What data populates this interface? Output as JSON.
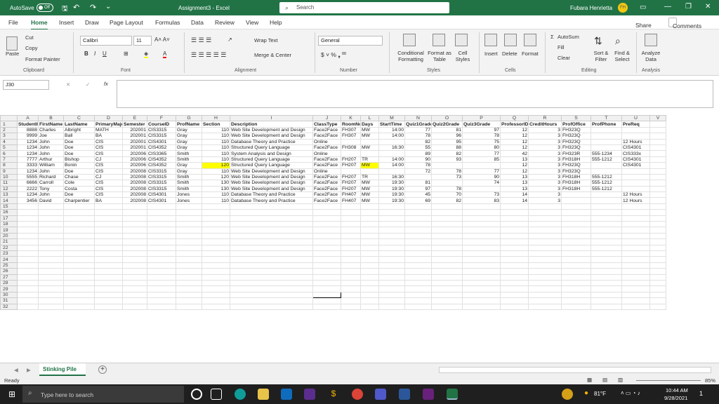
{
  "titlebar": {
    "autosave": "AutoSave",
    "toggle": "Off",
    "title": "Assignment3 - Excel",
    "search": "Search",
    "user": "Fubara Henrietta",
    "initials": "FH"
  },
  "menu": {
    "items": [
      "File",
      "Home",
      "Insert",
      "Draw",
      "Page Layout",
      "Formulas",
      "Data",
      "Review",
      "View",
      "Help"
    ],
    "share": "Share",
    "comments": "Comments"
  },
  "ribbon": {
    "cut": "Cut",
    "copy": "Copy",
    "paste": "Paste",
    "format_painter": "Format Painter",
    "clipboard": "Clipboard",
    "font_name": "Calibri",
    "font_size": "11",
    "font": "Font",
    "wrap": "Wrap Text",
    "merge": "Merge & Center",
    "alignment": "Alignment",
    "number_format": "General",
    "number": "Number",
    "cond": "Conditional Formatting",
    "format_table": "Format as Table",
    "cell_styles": "Cell Styles",
    "styles": "Styles",
    "insert": "Insert",
    "delete": "Delete",
    "format": "Format",
    "cells": "Cells",
    "autosum": "AutoSum",
    "fill": "Fill",
    "clear": "Clear",
    "sort": "Sort & Filter",
    "find": "Find & Select",
    "editing": "Editing",
    "analyze": "Analyze Data",
    "analysis": "Analysis"
  },
  "namebox": "J30",
  "columns": [
    "A",
    "B",
    "C",
    "D",
    "E",
    "F",
    "G",
    "H",
    "I",
    "J",
    "K",
    "L",
    "M",
    "N",
    "O",
    "P",
    "Q",
    "R",
    "S",
    "T",
    "U",
    "V"
  ],
  "rows": [
    [
      "StudentID",
      "FirstName",
      "LastName",
      "PrimaryMajor",
      "Semester",
      "CourseID",
      "ProfName",
      "Section",
      "Description",
      "ClassType",
      "RoomNo",
      "Days",
      "StartTime",
      "Quiz1Grade",
      "Quiz2Grade",
      "Quiz3Grade",
      "ProfessorID",
      "CreditHours",
      "ProfOffice",
      "ProfPhone",
      "PreReq"
    ],
    [
      "8888",
      "Charles",
      "Albright",
      "MATH",
      "202001",
      "CIS3315",
      "Gray",
      "110",
      "Web Site Development and Design",
      "Face2Face",
      "FH307",
      "MW",
      "14:00",
      "77",
      "81",
      "97",
      "12",
      "3",
      "FH323Q",
      "",
      ""
    ],
    [
      "9999",
      "Joe",
      "Ball",
      "BA",
      "202001",
      "CIS3315",
      "Gray",
      "110",
      "Web Site Development and Design",
      "Face2Face",
      "FH307",
      "MW",
      "14:00",
      "78",
      "96",
      "78",
      "12",
      "3",
      "FH323Q",
      "",
      ""
    ],
    [
      "1234",
      "John",
      "Doe",
      "CIS",
      "202001",
      "CIS4301",
      "Gray",
      "110",
      "Database Theory and Practice",
      "Online",
      "",
      "",
      "",
      "82",
      "95",
      "75",
      "12",
      "3",
      "FH323Q",
      "",
      "12 Hours"
    ],
    [
      "1234",
      "John",
      "Doe",
      "CIS",
      "202001",
      "CIS4352",
      "Gray",
      "110",
      "Structured Query Language",
      "Face2Face",
      "FH308",
      "MW",
      "16:30",
      "55",
      "88",
      "80",
      "12",
      "3",
      "FH323Q",
      "",
      "CIS4301"
    ],
    [
      "1234",
      "John",
      "Doe",
      "CIS",
      "202006",
      "CIS3365",
      "Smith",
      "110",
      "System Analysis and Design",
      "Online",
      "",
      "",
      "",
      "89",
      "82",
      "77",
      "42",
      "3",
      "FH323R",
      "555-1234",
      "CIS333x"
    ],
    [
      "7777",
      "Arthur",
      "Bishop",
      "CJ",
      "202006",
      "CIS4352",
      "Smith",
      "110",
      "Structured Query Language",
      "Face2Face",
      "FH207",
      "TR",
      "14:00",
      "90",
      "93",
      "85",
      "13",
      "3",
      "FH318H",
      "555-1212",
      "CIS4301"
    ],
    [
      "3333",
      "William",
      "Bonin",
      "CIS",
      "202006",
      "CIS4352",
      "Gray",
      "120",
      "Structured Query Language",
      "Face2Face",
      "FH207",
      "MW",
      "14:00",
      "78",
      "",
      "",
      "12",
      "3",
      "FH323Q",
      "",
      "CIS4301"
    ],
    [
      "1234",
      "John",
      "Doe",
      "CIS",
      "202008",
      "CIS3315",
      "Gray",
      "110",
      "Web Site Development and Design",
      "Online",
      "",
      "",
      "",
      "72",
      "78",
      "77",
      "12",
      "3",
      "FH323Q",
      "",
      ""
    ],
    [
      "5555",
      "Richard",
      "Chase",
      "CJ",
      "202008",
      "CIS3315",
      "Smith",
      "120",
      "Web Site Development and Design",
      "Face2Face",
      "FH207",
      "TR",
      "16:30",
      "",
      "73",
      "90",
      "13",
      "3",
      "FH318H",
      "555-1212",
      ""
    ],
    [
      "6666",
      "Carroll",
      "Cole",
      "CIS",
      "202008",
      "CIS3315",
      "Smith",
      "130",
      "Web Site Development and Design",
      "Face2Face",
      "FH207",
      "MW",
      "19:30",
      "81",
      "",
      "74",
      "13",
      "3",
      "FH318H",
      "555-1212",
      ""
    ],
    [
      "2222",
      "Tony",
      "Costa",
      "CIS",
      "202008",
      "CIS3315",
      "Smith",
      "130",
      "Web Site Development and Design",
      "Face2Face",
      "FH207",
      "MW",
      "19:30",
      "97",
      "78",
      "",
      "13",
      "3",
      "FH318H",
      "555-1212",
      ""
    ],
    [
      "1234",
      "John",
      "Doe",
      "CIS",
      "202008",
      "CIS4301",
      "Jones",
      "110",
      "Database Theory and Practice",
      "Face2Face",
      "FH407",
      "MW",
      "19:30",
      "45",
      "70",
      "73",
      "14",
      "3",
      "",
      "",
      "12 Hours"
    ],
    [
      "3456",
      "David",
      "Charpentier",
      "BA",
      "202008",
      "CIS4301",
      "Jones",
      "110",
      "Database Theory and Practice",
      "Face2Face",
      "FH407",
      "MW",
      "19:30",
      "69",
      "82",
      "83",
      "14",
      "3",
      "",
      "",
      "12 Hours"
    ]
  ],
  "sheet": {
    "tab": "Stinking Pile",
    "add": "+"
  },
  "status": {
    "ready": "Ready",
    "zoom": "85%"
  },
  "taskbar": {
    "search": "Type here to search",
    "temp": "81°F",
    "time": "10:44 AM",
    "date": "9/28/2021",
    "notif": "1"
  }
}
